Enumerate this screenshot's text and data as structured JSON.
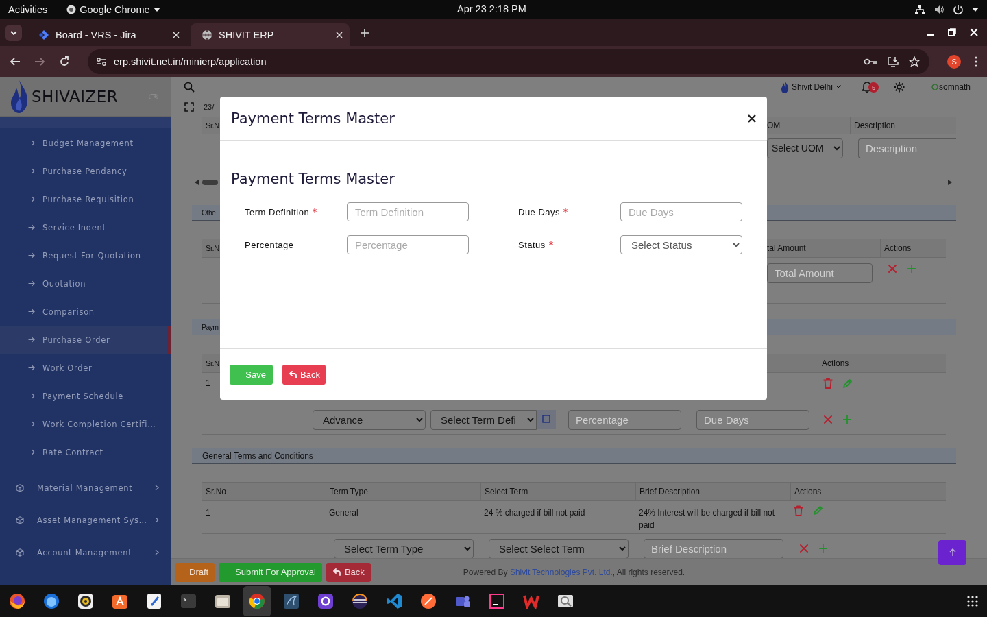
{
  "system_bar": {
    "activities": "Activities",
    "app_menu": "Google Chrome",
    "clock": "Apr 23  2:18 PM"
  },
  "browser": {
    "tabs": [
      {
        "title": "Board - VRS - Jira",
        "selected": false
      },
      {
        "title": "SHIVIT ERP",
        "selected": true
      }
    ],
    "url": "erp.shivit.net.in/minierp/application",
    "profile": "S"
  },
  "sidebar": {
    "brand": "SHIVAIZER",
    "items": [
      {
        "label": "Budget Management",
        "kind": "link",
        "selected": false
      },
      {
        "label": "Purchase Pendancy",
        "kind": "link",
        "selected": false
      },
      {
        "label": "Purchase Requisition",
        "kind": "link",
        "selected": false
      },
      {
        "label": "Service Indent",
        "kind": "link",
        "selected": false
      },
      {
        "label": "Request For Quotation",
        "kind": "link",
        "selected": false
      },
      {
        "label": "Quotation",
        "kind": "link",
        "selected": false
      },
      {
        "label": "Comparison",
        "kind": "link",
        "selected": false
      },
      {
        "label": "Purchase Order",
        "kind": "link",
        "selected": true
      },
      {
        "label": "Work Order",
        "kind": "link",
        "selected": false
      },
      {
        "label": "Payment Schedule",
        "kind": "link",
        "selected": false
      },
      {
        "label": "Work Completion Certifi…",
        "kind": "link",
        "selected": false
      },
      {
        "label": "Rate Contract",
        "kind": "link",
        "selected": false
      },
      {
        "label": "Material Management",
        "kind": "group",
        "selected": false
      },
      {
        "label": "Asset Management Sys…",
        "kind": "group",
        "selected": false
      },
      {
        "label": "Account Management",
        "kind": "group",
        "selected": false
      }
    ]
  },
  "header": {
    "branch": "Shivit Delhi",
    "notifications": "5",
    "user": "somnath",
    "date": "23/"
  },
  "item_table": {
    "columns": [
      "Sr.N",
      "OM",
      "Description"
    ],
    "uom_select": {
      "value": "Select UOM"
    },
    "description_field": {
      "placeholder": "Description"
    }
  },
  "other_section": {
    "title": "Othe",
    "columns": [
      "Sr.N",
      "tal Amount",
      "Actions"
    ],
    "total_amount_field": {
      "placeholder": "Total Amount"
    }
  },
  "payment_section": {
    "title": "Paym",
    "columns": [
      "Sr.N",
      "Actions"
    ],
    "rows": [
      {
        "sr": "1"
      }
    ],
    "new_row": [
      {
        "kind": "select",
        "value": "Advance"
      },
      {
        "kind": "select",
        "value": "Select Term Defi"
      },
      {
        "kind": "input",
        "placeholder": "Percentage"
      },
      {
        "kind": "input",
        "placeholder": "Due Days"
      }
    ]
  },
  "general_terms": {
    "title": "General Terms and Conditions",
    "columns": [
      "Sr.No",
      "Term Type",
      "Select Term",
      "Brief Description",
      "Actions"
    ],
    "rows": [
      {
        "sr": "1",
        "term_type": "General",
        "term": "24 % charged if bill not paid",
        "description": "24% Interest will be charged if bill not paid"
      }
    ],
    "new_row": [
      {
        "kind": "select",
        "value": "Select Term Type"
      },
      {
        "kind": "select",
        "value": "Select Select Term"
      },
      {
        "kind": "input",
        "placeholder": "Brief Description"
      }
    ]
  },
  "footer": {
    "buttons": [
      {
        "label": "Draft",
        "kind": "draft"
      },
      {
        "label": "Submit For Approval",
        "kind": "submit"
      },
      {
        "label": "Back",
        "kind": "back"
      }
    ],
    "powered_by": "Powered By",
    "company": "Shivit Technologies Pvt. Ltd.",
    "rights": ", All rights reserved."
  },
  "modal": {
    "title": "Payment Terms Master",
    "heading": "Payment Terms Master",
    "fields": [
      {
        "label": "Term Definition",
        "required": true,
        "kind": "input",
        "placeholder": "Term Definition"
      },
      {
        "label": "Due Days",
        "required": true,
        "kind": "input",
        "placeholder": "Due Days"
      },
      {
        "label": "Percentage",
        "required": false,
        "kind": "input",
        "placeholder": "Percentage"
      },
      {
        "label": "Status",
        "required": true,
        "kind": "select",
        "value": "Select Status"
      }
    ],
    "buttons": [
      {
        "label": "Save",
        "kind": "save"
      },
      {
        "label": "Back",
        "kind": "back"
      }
    ]
  }
}
